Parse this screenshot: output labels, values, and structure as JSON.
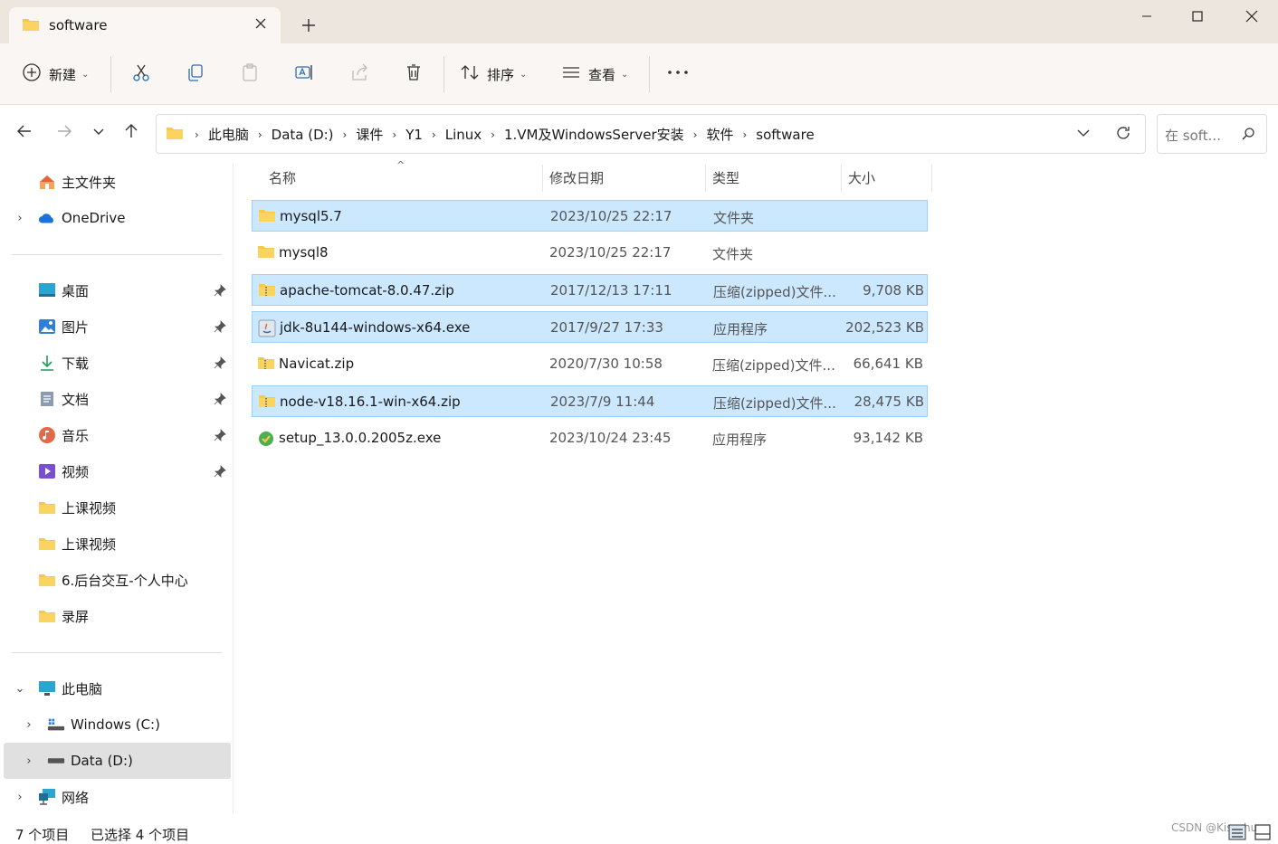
{
  "window": {
    "tab_title": "software"
  },
  "toolbar": {
    "new_label": "新建",
    "sort_label": "排序",
    "view_label": "查看"
  },
  "address": {
    "crumbs": [
      "此电脑",
      "Data (D:)",
      "课件",
      "Y1",
      "Linux",
      "1.VM及WindowsServer安装",
      "软件",
      "software"
    ],
    "search_placeholder": "在 soft..."
  },
  "sidebar": {
    "home": "主文件夹",
    "onedrive": "OneDrive",
    "quick": [
      {
        "label": "桌面",
        "icon": "desktop-icon"
      },
      {
        "label": "图片",
        "icon": "pictures-icon"
      },
      {
        "label": "下载",
        "icon": "downloads-icon"
      },
      {
        "label": "文档",
        "icon": "documents-icon"
      },
      {
        "label": "音乐",
        "icon": "music-icon"
      },
      {
        "label": "视频",
        "icon": "videos-icon"
      },
      {
        "label": "上课视频",
        "icon": "folder-icon"
      },
      {
        "label": "上课视频",
        "icon": "folder-icon"
      },
      {
        "label": "6.后台交互-个人中心",
        "icon": "folder-icon"
      },
      {
        "label": "录屏",
        "icon": "folder-icon"
      }
    ],
    "this_pc": "此电脑",
    "drives": [
      {
        "label": "Windows (C:)"
      },
      {
        "label": "Data (D:)"
      }
    ],
    "network": "网络"
  },
  "columns": {
    "name": "名称",
    "date": "修改日期",
    "type": "类型",
    "size": "大小"
  },
  "files": [
    {
      "name": "mysql5.7",
      "date": "2023/10/25 22:17",
      "type": "文件夹",
      "size": "",
      "icon": "folder-icon",
      "selected": true
    },
    {
      "name": "mysql8",
      "date": "2023/10/25 22:17",
      "type": "文件夹",
      "size": "",
      "icon": "folder-icon",
      "selected": false
    },
    {
      "name": "apache-tomcat-8.0.47.zip",
      "date": "2017/12/13 17:11",
      "type": "压缩(zipped)文件...",
      "size": "9,708 KB",
      "icon": "zip-icon",
      "selected": true
    },
    {
      "name": "jdk-8u144-windows-x64.exe",
      "date": "2017/9/27 17:33",
      "type": "应用程序",
      "size": "202,523 KB",
      "icon": "installer-icon",
      "selected": true
    },
    {
      "name": "Navicat.zip",
      "date": "2020/7/30 10:58",
      "type": "压缩(zipped)文件...",
      "size": "66,641 KB",
      "icon": "zip-icon",
      "selected": false
    },
    {
      "name": "node-v18.16.1-win-x64.zip",
      "date": "2023/7/9 11:44",
      "type": "压缩(zipped)文件...",
      "size": "28,475 KB",
      "icon": "zip-icon",
      "selected": true
    },
    {
      "name": "setup_13.0.0.2005z.exe",
      "date": "2023/10/24 23:45",
      "type": "应用程序",
      "size": "93,142 KB",
      "icon": "setup-icon",
      "selected": false
    }
  ],
  "status": {
    "count": "7 个项目",
    "selected": "已选择 4 个项目",
    "watermark": "CSDN @Kissshu"
  },
  "colors": {
    "selection_bg": "#cce8ff",
    "selection_border": "#99d1ff",
    "titlebar_bg": "#ede6df",
    "toolbar_bg": "#faf6f3",
    "folder_yellow": "#f8c948"
  }
}
